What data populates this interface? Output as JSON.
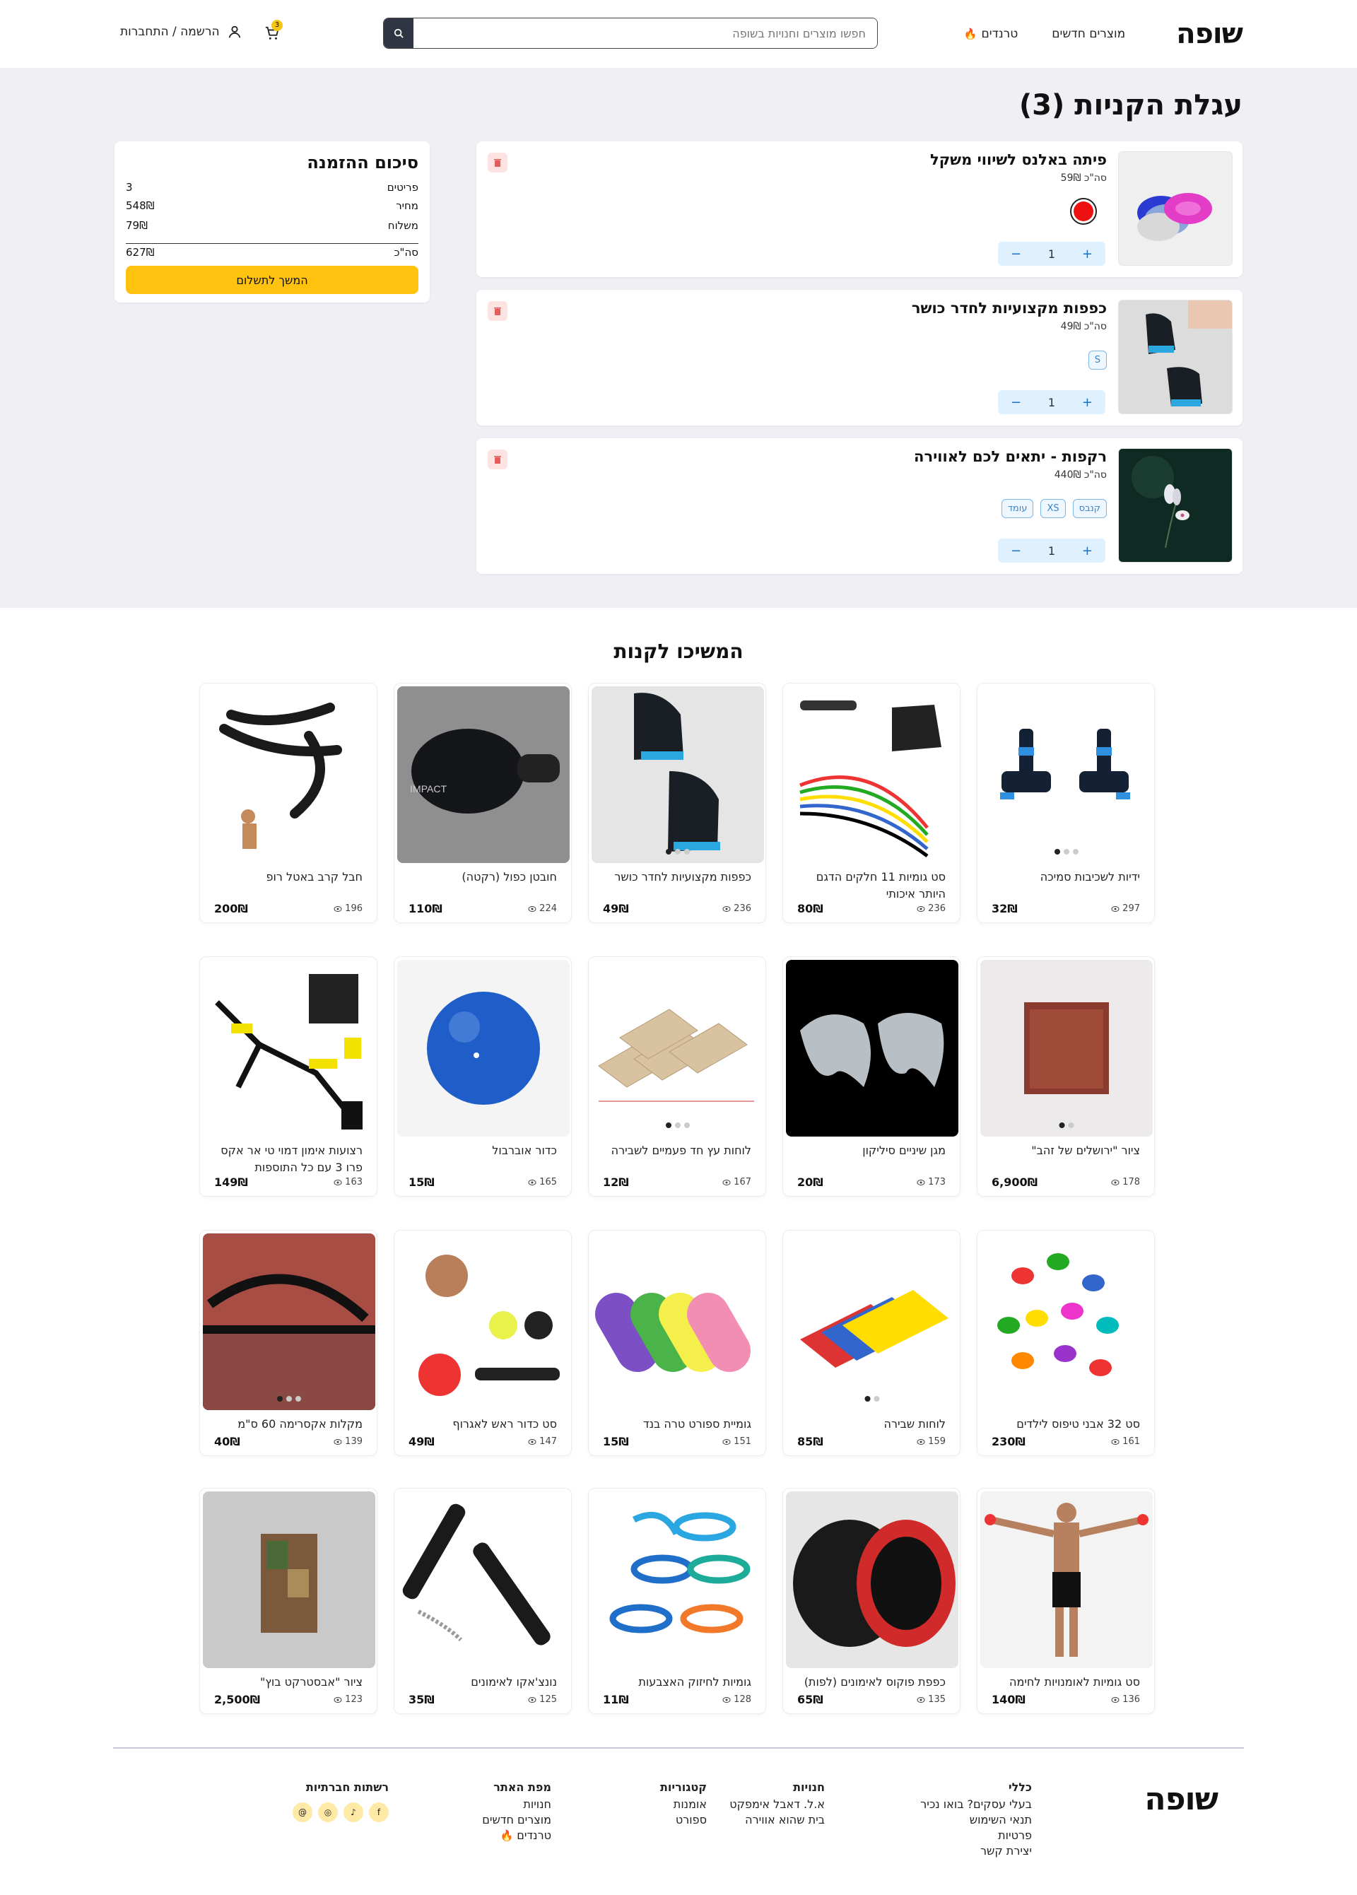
{
  "header": {
    "logo": "שופה",
    "nav": [
      {
        "label": "מוצרים חדשים"
      },
      {
        "label": "טרנדים"
      }
    ],
    "search_placeholder": "חפשו מוצרים וחנויות בשופה",
    "cart_count": "3",
    "login_label": "הרשמה / התחברות"
  },
  "cart": {
    "title": "עגלת הקניות (3)",
    "items": [
      {
        "title": "פיתה באלנס לשיווי משקל",
        "price": "סה\"כ 59₪",
        "qty": "1",
        "color": "#ee1111"
      },
      {
        "title": "כפפות מקצועיות לחדר כושר",
        "price": "סה\"כ 49₪",
        "qty": "1",
        "chips": [
          "S"
        ]
      },
      {
        "title": "רקפות - יתאים לכם לאווירה",
        "price": "סה\"כ 440₪",
        "qty": "1",
        "chips": [
          "קנבס",
          "XS",
          "עומד"
        ]
      }
    ],
    "plus": "+",
    "minus": "−"
  },
  "summary": {
    "title": "סיכום ההזמנה",
    "rows": [
      {
        "label": "פריטים",
        "value": "3"
      },
      {
        "label": "מחיר",
        "value": "548₪"
      },
      {
        "label": "משלוח",
        "value": "79₪"
      }
    ],
    "total_label": "סה\"כ",
    "total_value": "627₪",
    "checkout_label": "המשך לתשלום"
  },
  "continue": {
    "title": "המשיכו לקנות",
    "products": [
      {
        "title": "ידיות לשכיבות סמיכה",
        "price": "32₪",
        "views": "297",
        "img": "pushup",
        "dots": 3
      },
      {
        "title": "סט גומיות 11 חלקים הדגם היותר איכותי",
        "price": "80₪",
        "views": "236",
        "img": "bands"
      },
      {
        "title": "כפפות מקצועיות לחדר כושר",
        "price": "49₪",
        "views": "236",
        "img": "gloves",
        "dots": 3
      },
      {
        "title": "חובטן כפול (רקטה)",
        "price": "110₪",
        "views": "224",
        "img": "paddle"
      },
      {
        "title": "חבל קרב באטל רופ",
        "price": "200₪",
        "views": "196",
        "img": "rope"
      },
      {
        "title": "ציור \"ירושלים של זהב\"",
        "price": "6,900₪",
        "views": "178",
        "img": "painting",
        "dots": 2
      },
      {
        "title": "מגן שיניים סיליקון",
        "price": "20₪",
        "views": "173",
        "img": "mouth"
      },
      {
        "title": "לוחות עץ חד פעמיים לשבירה",
        "price": "12₪",
        "views": "167",
        "img": "boards",
        "dots": 3
      },
      {
        "title": "כדור אוברבול",
        "price": "15₪",
        "views": "165",
        "img": "ball"
      },
      {
        "title": "רצועות אימון דמוי טי אר אקס פרו 3 עם כל התוספות",
        "price": "149₪",
        "views": "163",
        "img": "trx"
      },
      {
        "title": "סט 32 אבני טיפוס לילדים",
        "price": "230₪",
        "views": "161",
        "img": "climb"
      },
      {
        "title": "לוחות שבירה",
        "price": "85₪",
        "views": "159",
        "img": "rebreak",
        "dots": 2
      },
      {
        "title": "גומיית ספורט טרה בנד",
        "price": "15₪",
        "views": "151",
        "img": "theraband"
      },
      {
        "title": "סט כדור ראש לאגרוף",
        "price": "49₪",
        "views": "147",
        "img": "headball"
      },
      {
        "title": "מקלות אקסרימה 60 ס\"מ",
        "price": "40₪",
        "views": "139",
        "img": "sticks",
        "dots": 3
      },
      {
        "title": "סט גומיות לאומנויות לחימה",
        "price": "140₪",
        "views": "136",
        "img": "athlete"
      },
      {
        "title": "כפפת פוקוס לאימונים (לפות)",
        "price": "65₪",
        "views": "135",
        "img": "focus"
      },
      {
        "title": "גומיות לחיזוק האצבעות",
        "price": "11₪",
        "views": "128",
        "img": "finger"
      },
      {
        "title": "נונצ'אקו לאימונים",
        "price": "35₪",
        "views": "125",
        "img": "nunchaku"
      },
      {
        "title": "ציור \"אבסטרקט בוץ\"",
        "price": "2,500₪",
        "views": "123",
        "img": "abstract"
      }
    ]
  },
  "footer": {
    "logo": "שופה",
    "cols": [
      {
        "title": "כללי",
        "items": [
          "בעלי עסקים? בואו נכיר",
          "תנאי השימוש",
          "פרטיות",
          "יצירת קשר"
        ]
      },
      {
        "title": "חנויות",
        "items": [
          "א.ל. דאבל אימפקט",
          "בית שהוא אווירה"
        ]
      },
      {
        "title": "קטגוריות",
        "items": [
          "אומנות",
          "ספורט"
        ]
      },
      {
        "title": "מפת האתר",
        "items": [
          "חנויות",
          "מוצרים חדשים",
          "טרנדים"
        ]
      },
      {
        "title": "רשתות חברתיות",
        "items": []
      }
    ]
  },
  "colors": {
    "accent": "#ffc20e",
    "bg_cart": "#efeff4",
    "search_btn": "#2f3542"
  }
}
